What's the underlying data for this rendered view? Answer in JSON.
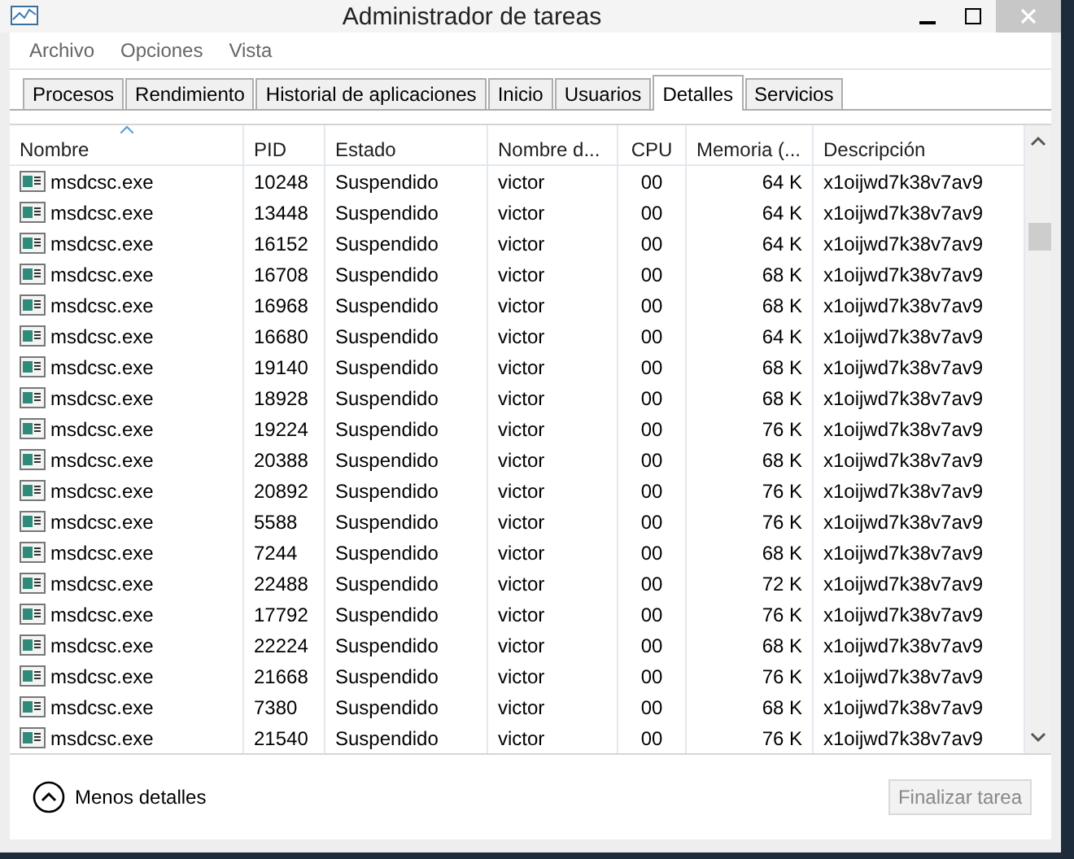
{
  "window": {
    "title": "Administrador de tareas"
  },
  "menu": [
    "Archivo",
    "Opciones",
    "Vista"
  ],
  "tabs": [
    {
      "label": "Procesos",
      "selected": false
    },
    {
      "label": "Rendimiento",
      "selected": false
    },
    {
      "label": "Historial de aplicaciones",
      "selected": false
    },
    {
      "label": "Inicio",
      "selected": false
    },
    {
      "label": "Usuarios",
      "selected": false
    },
    {
      "label": "Detalles",
      "selected": true
    },
    {
      "label": "Servicios",
      "selected": false
    }
  ],
  "table": {
    "columns": [
      {
        "label": "Nombre",
        "sorted": true
      },
      {
        "label": "PID",
        "sorted": false
      },
      {
        "label": "Estado",
        "sorted": false
      },
      {
        "label": "Nombre d...",
        "sorted": false
      },
      {
        "label": "CPU",
        "sorted": false
      },
      {
        "label": "Memoria (...",
        "sorted": false
      },
      {
        "label": "Descripción",
        "sorted": false
      }
    ],
    "rows": [
      [
        "msdcsc.exe",
        "10248",
        "Suspendido",
        "victor",
        "00",
        "64 K",
        "x1oijwd7k38v7av9"
      ],
      [
        "msdcsc.exe",
        "13448",
        "Suspendido",
        "victor",
        "00",
        "64 K",
        "x1oijwd7k38v7av9"
      ],
      [
        "msdcsc.exe",
        "16152",
        "Suspendido",
        "victor",
        "00",
        "64 K",
        "x1oijwd7k38v7av9"
      ],
      [
        "msdcsc.exe",
        "16708",
        "Suspendido",
        "victor",
        "00",
        "68 K",
        "x1oijwd7k38v7av9"
      ],
      [
        "msdcsc.exe",
        "16968",
        "Suspendido",
        "victor",
        "00",
        "68 K",
        "x1oijwd7k38v7av9"
      ],
      [
        "msdcsc.exe",
        "16680",
        "Suspendido",
        "victor",
        "00",
        "64 K",
        "x1oijwd7k38v7av9"
      ],
      [
        "msdcsc.exe",
        "19140",
        "Suspendido",
        "victor",
        "00",
        "68 K",
        "x1oijwd7k38v7av9"
      ],
      [
        "msdcsc.exe",
        "18928",
        "Suspendido",
        "victor",
        "00",
        "68 K",
        "x1oijwd7k38v7av9"
      ],
      [
        "msdcsc.exe",
        "19224",
        "Suspendido",
        "victor",
        "00",
        "76 K",
        "x1oijwd7k38v7av9"
      ],
      [
        "msdcsc.exe",
        "20388",
        "Suspendido",
        "victor",
        "00",
        "68 K",
        "x1oijwd7k38v7av9"
      ],
      [
        "msdcsc.exe",
        "20892",
        "Suspendido",
        "victor",
        "00",
        "76 K",
        "x1oijwd7k38v7av9"
      ],
      [
        "msdcsc.exe",
        "5588",
        "Suspendido",
        "victor",
        "00",
        "76 K",
        "x1oijwd7k38v7av9"
      ],
      [
        "msdcsc.exe",
        "7244",
        "Suspendido",
        "victor",
        "00",
        "68 K",
        "x1oijwd7k38v7av9"
      ],
      [
        "msdcsc.exe",
        "22488",
        "Suspendido",
        "victor",
        "00",
        "72 K",
        "x1oijwd7k38v7av9"
      ],
      [
        "msdcsc.exe",
        "17792",
        "Suspendido",
        "victor",
        "00",
        "76 K",
        "x1oijwd7k38v7av9"
      ],
      [
        "msdcsc.exe",
        "22224",
        "Suspendido",
        "victor",
        "00",
        "68 K",
        "x1oijwd7k38v7av9"
      ],
      [
        "msdcsc.exe",
        "21668",
        "Suspendido",
        "victor",
        "00",
        "76 K",
        "x1oijwd7k38v7av9"
      ],
      [
        "msdcsc.exe",
        "7380",
        "Suspendido",
        "victor",
        "00",
        "68 K",
        "x1oijwd7k38v7av9"
      ],
      [
        "msdcsc.exe",
        "21540",
        "Suspendido",
        "victor",
        "00",
        "76 K",
        "x1oijwd7k38v7av9"
      ]
    ]
  },
  "footer": {
    "less_details": "Menos detalles",
    "end_task": {
      "label": "Finalizar tarea",
      "disabled": true
    }
  }
}
